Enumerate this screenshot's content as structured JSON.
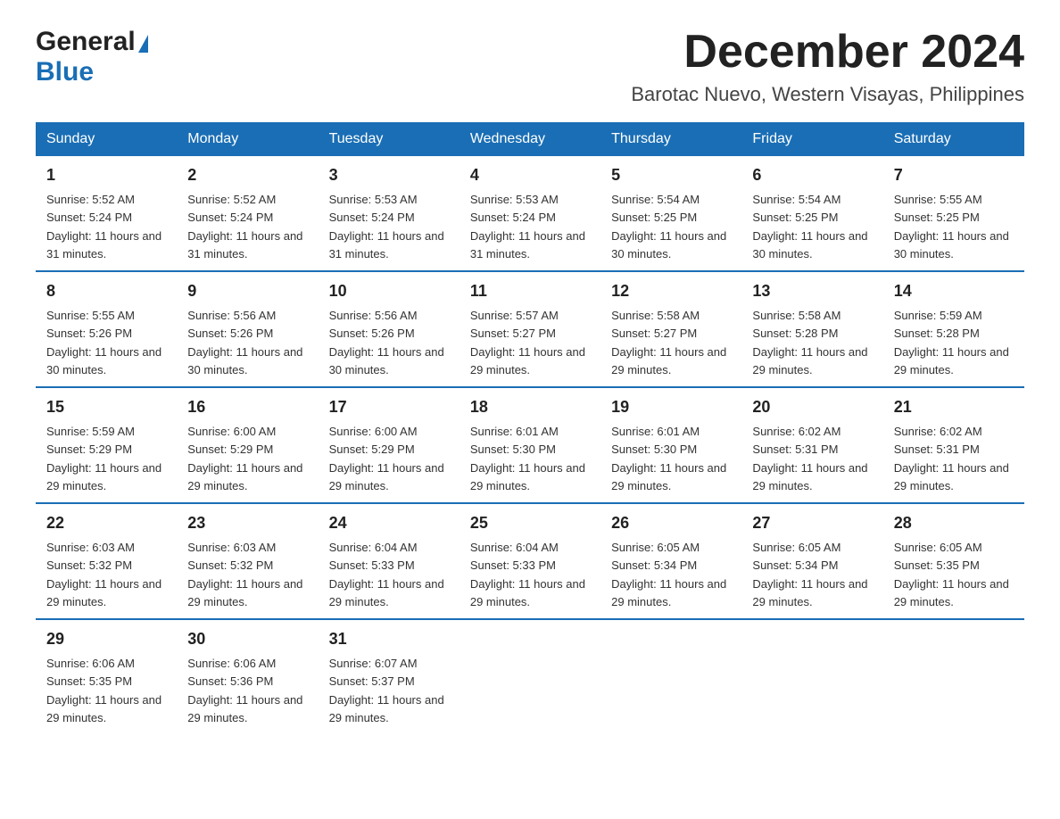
{
  "logo": {
    "general": "General",
    "blue": "Blue"
  },
  "title": "December 2024",
  "subtitle": "Barotac Nuevo, Western Visayas, Philippines",
  "header_color": "#1a6eb5",
  "days_of_week": [
    "Sunday",
    "Monday",
    "Tuesday",
    "Wednesday",
    "Thursday",
    "Friday",
    "Saturday"
  ],
  "weeks": [
    [
      {
        "day": "1",
        "sunrise": "Sunrise: 5:52 AM",
        "sunset": "Sunset: 5:24 PM",
        "daylight": "Daylight: 11 hours and 31 minutes."
      },
      {
        "day": "2",
        "sunrise": "Sunrise: 5:52 AM",
        "sunset": "Sunset: 5:24 PM",
        "daylight": "Daylight: 11 hours and 31 minutes."
      },
      {
        "day": "3",
        "sunrise": "Sunrise: 5:53 AM",
        "sunset": "Sunset: 5:24 PM",
        "daylight": "Daylight: 11 hours and 31 minutes."
      },
      {
        "day": "4",
        "sunrise": "Sunrise: 5:53 AM",
        "sunset": "Sunset: 5:24 PM",
        "daylight": "Daylight: 11 hours and 31 minutes."
      },
      {
        "day": "5",
        "sunrise": "Sunrise: 5:54 AM",
        "sunset": "Sunset: 5:25 PM",
        "daylight": "Daylight: 11 hours and 30 minutes."
      },
      {
        "day": "6",
        "sunrise": "Sunrise: 5:54 AM",
        "sunset": "Sunset: 5:25 PM",
        "daylight": "Daylight: 11 hours and 30 minutes."
      },
      {
        "day": "7",
        "sunrise": "Sunrise: 5:55 AM",
        "sunset": "Sunset: 5:25 PM",
        "daylight": "Daylight: 11 hours and 30 minutes."
      }
    ],
    [
      {
        "day": "8",
        "sunrise": "Sunrise: 5:55 AM",
        "sunset": "Sunset: 5:26 PM",
        "daylight": "Daylight: 11 hours and 30 minutes."
      },
      {
        "day": "9",
        "sunrise": "Sunrise: 5:56 AM",
        "sunset": "Sunset: 5:26 PM",
        "daylight": "Daylight: 11 hours and 30 minutes."
      },
      {
        "day": "10",
        "sunrise": "Sunrise: 5:56 AM",
        "sunset": "Sunset: 5:26 PM",
        "daylight": "Daylight: 11 hours and 30 minutes."
      },
      {
        "day": "11",
        "sunrise": "Sunrise: 5:57 AM",
        "sunset": "Sunset: 5:27 PM",
        "daylight": "Daylight: 11 hours and 29 minutes."
      },
      {
        "day": "12",
        "sunrise": "Sunrise: 5:58 AM",
        "sunset": "Sunset: 5:27 PM",
        "daylight": "Daylight: 11 hours and 29 minutes."
      },
      {
        "day": "13",
        "sunrise": "Sunrise: 5:58 AM",
        "sunset": "Sunset: 5:28 PM",
        "daylight": "Daylight: 11 hours and 29 minutes."
      },
      {
        "day": "14",
        "sunrise": "Sunrise: 5:59 AM",
        "sunset": "Sunset: 5:28 PM",
        "daylight": "Daylight: 11 hours and 29 minutes."
      }
    ],
    [
      {
        "day": "15",
        "sunrise": "Sunrise: 5:59 AM",
        "sunset": "Sunset: 5:29 PM",
        "daylight": "Daylight: 11 hours and 29 minutes."
      },
      {
        "day": "16",
        "sunrise": "Sunrise: 6:00 AM",
        "sunset": "Sunset: 5:29 PM",
        "daylight": "Daylight: 11 hours and 29 minutes."
      },
      {
        "day": "17",
        "sunrise": "Sunrise: 6:00 AM",
        "sunset": "Sunset: 5:29 PM",
        "daylight": "Daylight: 11 hours and 29 minutes."
      },
      {
        "day": "18",
        "sunrise": "Sunrise: 6:01 AM",
        "sunset": "Sunset: 5:30 PM",
        "daylight": "Daylight: 11 hours and 29 minutes."
      },
      {
        "day": "19",
        "sunrise": "Sunrise: 6:01 AM",
        "sunset": "Sunset: 5:30 PM",
        "daylight": "Daylight: 11 hours and 29 minutes."
      },
      {
        "day": "20",
        "sunrise": "Sunrise: 6:02 AM",
        "sunset": "Sunset: 5:31 PM",
        "daylight": "Daylight: 11 hours and 29 minutes."
      },
      {
        "day": "21",
        "sunrise": "Sunrise: 6:02 AM",
        "sunset": "Sunset: 5:31 PM",
        "daylight": "Daylight: 11 hours and 29 minutes."
      }
    ],
    [
      {
        "day": "22",
        "sunrise": "Sunrise: 6:03 AM",
        "sunset": "Sunset: 5:32 PM",
        "daylight": "Daylight: 11 hours and 29 minutes."
      },
      {
        "day": "23",
        "sunrise": "Sunrise: 6:03 AM",
        "sunset": "Sunset: 5:32 PM",
        "daylight": "Daylight: 11 hours and 29 minutes."
      },
      {
        "day": "24",
        "sunrise": "Sunrise: 6:04 AM",
        "sunset": "Sunset: 5:33 PM",
        "daylight": "Daylight: 11 hours and 29 minutes."
      },
      {
        "day": "25",
        "sunrise": "Sunrise: 6:04 AM",
        "sunset": "Sunset: 5:33 PM",
        "daylight": "Daylight: 11 hours and 29 minutes."
      },
      {
        "day": "26",
        "sunrise": "Sunrise: 6:05 AM",
        "sunset": "Sunset: 5:34 PM",
        "daylight": "Daylight: 11 hours and 29 minutes."
      },
      {
        "day": "27",
        "sunrise": "Sunrise: 6:05 AM",
        "sunset": "Sunset: 5:34 PM",
        "daylight": "Daylight: 11 hours and 29 minutes."
      },
      {
        "day": "28",
        "sunrise": "Sunrise: 6:05 AM",
        "sunset": "Sunset: 5:35 PM",
        "daylight": "Daylight: 11 hours and 29 minutes."
      }
    ],
    [
      {
        "day": "29",
        "sunrise": "Sunrise: 6:06 AM",
        "sunset": "Sunset: 5:35 PM",
        "daylight": "Daylight: 11 hours and 29 minutes."
      },
      {
        "day": "30",
        "sunrise": "Sunrise: 6:06 AM",
        "sunset": "Sunset: 5:36 PM",
        "daylight": "Daylight: 11 hours and 29 minutes."
      },
      {
        "day": "31",
        "sunrise": "Sunrise: 6:07 AM",
        "sunset": "Sunset: 5:37 PM",
        "daylight": "Daylight: 11 hours and 29 minutes."
      },
      null,
      null,
      null,
      null
    ]
  ]
}
